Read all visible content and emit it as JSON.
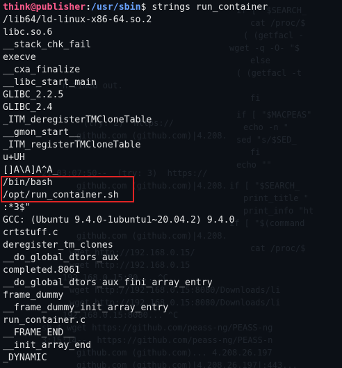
{
  "terminal": {
    "prompt": {
      "user_host": "think@publisher",
      "separator": ":",
      "path": "/usr/sbin",
      "symbol": "$",
      "command": " strings run_container"
    },
    "output_lines": [
      "/lib64/ld-linux-x86-64.so.2",
      "libc.so.6",
      "__stack_chk_fail",
      "execve",
      "__cxa_finalize",
      "__libc_start_main",
      "GLIBC_2.2.5",
      "GLIBC_2.4",
      "_ITM_deregisterTMCloneTable",
      "__gmon_start__",
      "_ITM_registerTMCloneTable",
      "u+UH",
      "[]A\\A]A^A_",
      "/bin/bash",
      "/opt/run_container.sh",
      ":*3$\"",
      "GCC: (Ubuntu 9.4.0-1ubuntu1~20.04.2) 9.4.0",
      "crtstuff.c",
      "deregister_tm_clones",
      "__do_global_dtors_aux",
      "completed.8061",
      "__do_global_dtors_aux_fini_array_entry",
      "frame_dummy",
      "__frame_dummy_init_array_entry",
      "run_container.c",
      "__FRAME_END__",
      "__init_array_end",
      "_DYNAMIC"
    ]
  },
  "colors": {
    "background": "#0c1016",
    "text": "#e6e6e6",
    "user_host": "#ff5c8d",
    "path": "#6aa3ff",
    "highlight_border": "#e02424"
  }
}
